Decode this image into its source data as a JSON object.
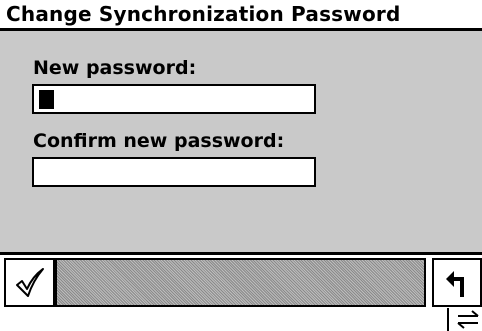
{
  "window": {
    "title": "Change Synchronization Password"
  },
  "form": {
    "new_password_label": "New password:",
    "new_password_value": "",
    "confirm_password_label": "Confirm new password:",
    "confirm_password_value": ""
  },
  "toolbar": {
    "ok_icon": "checkmark-icon",
    "back_icon": "return-arrow-icon"
  },
  "status": {
    "sync_icon": "sync-arrows-icon"
  },
  "colors": {
    "panel_background": "#c9c9c9",
    "text": "#000000",
    "field_background": "#ffffff"
  }
}
